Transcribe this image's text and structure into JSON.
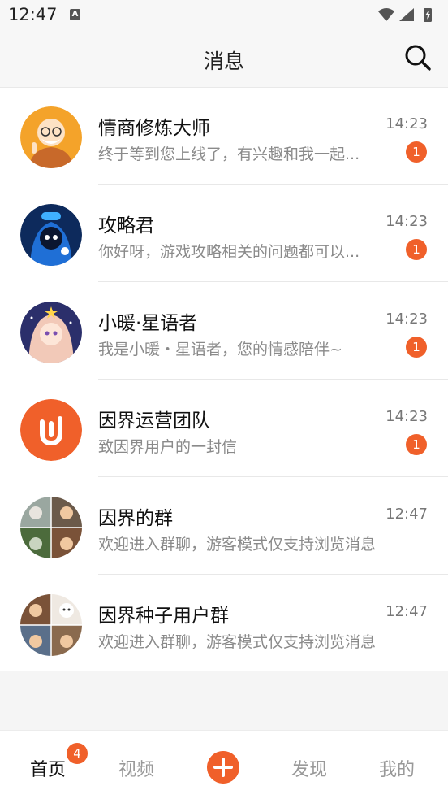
{
  "status_bar": {
    "time": "12:47",
    "notification_icon": "A"
  },
  "header": {
    "title": "消息"
  },
  "chats": [
    {
      "name": "情商修炼大师",
      "time": "14:23",
      "preview": "终于等到您上线了，有兴趣和我一起...",
      "unread": "1",
      "avatar": "monk-avatar"
    },
    {
      "name": "攻略君",
      "time": "14:23",
      "preview": "你好呀，游戏攻略相关的问题都可以...",
      "unread": "1",
      "avatar": "gamer-avatar"
    },
    {
      "name": "小暖·星语者",
      "time": "14:23",
      "preview": "我是小暖・星语者，您的情感陪伴~",
      "unread": "1",
      "avatar": "star-girl-avatar"
    },
    {
      "name": "因界运营团队",
      "time": "14:23",
      "preview": "致因界用户的一封信",
      "unread": "1",
      "avatar": "brand-logo-avatar"
    },
    {
      "name": "因界的群",
      "time": "12:47",
      "preview": "欢迎进入群聊，游客模式仅支持浏览消息",
      "unread": "",
      "avatar": "group-collage-avatar"
    },
    {
      "name": "因界种子用户群",
      "time": "12:47",
      "preview": "欢迎进入群聊，游客模式仅支持浏览消息",
      "unread": "",
      "avatar": "group-collage-avatar"
    }
  ],
  "tabbar": {
    "home": "首页",
    "home_badge": "4",
    "video": "视频",
    "discover": "发现",
    "mine": "我的"
  },
  "colors": {
    "accent": "#f0602a"
  }
}
